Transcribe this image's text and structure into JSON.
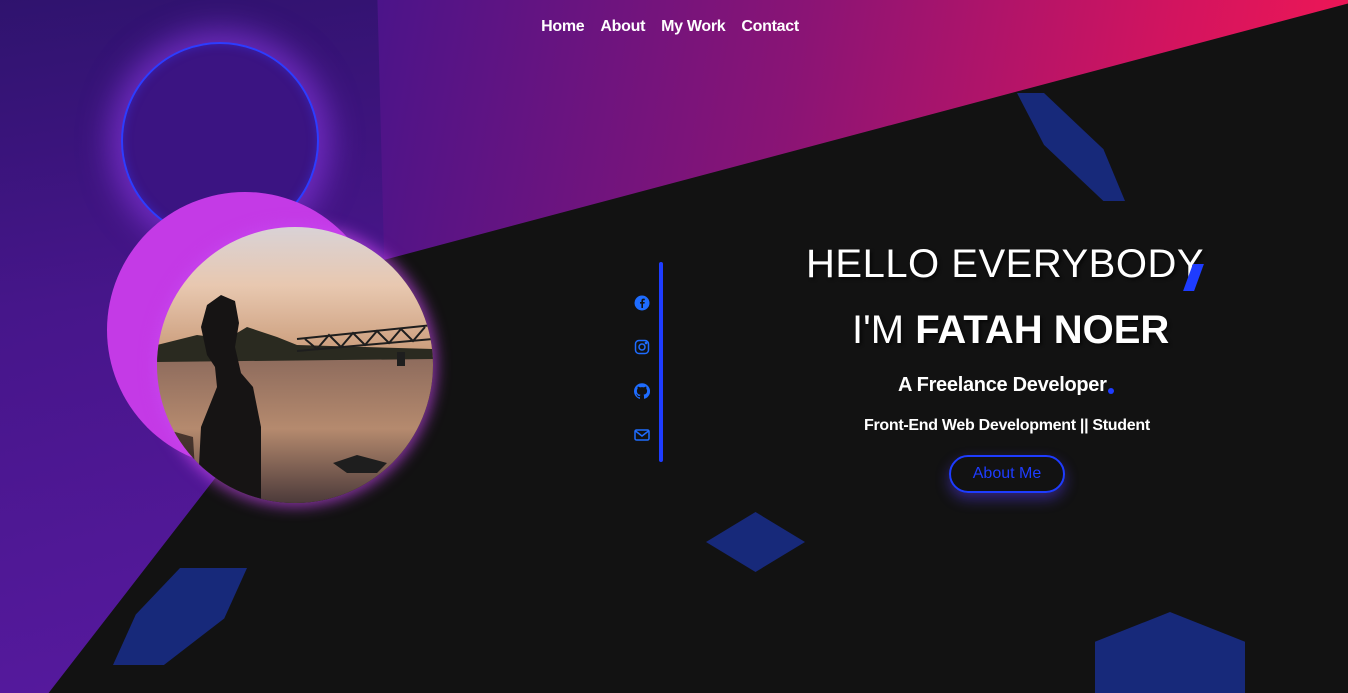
{
  "nav": {
    "items": [
      {
        "label": "Home"
      },
      {
        "label": "About"
      },
      {
        "label": "My Work"
      },
      {
        "label": "Contact"
      }
    ]
  },
  "hero": {
    "greeting": "HELLO EVERYBODY",
    "intro_prefix": "I'M",
    "name": "FATAH NOER",
    "role": "A Freelance Developer",
    "tagline": "Front-End Web Development || Student",
    "cta_label": "About Me"
  },
  "social": [
    {
      "icon": "facebook-icon"
    },
    {
      "icon": "instagram-icon"
    },
    {
      "icon": "github-icon"
    },
    {
      "icon": "mail-icon"
    }
  ],
  "colors": {
    "accent": "#1e3cff",
    "background": "#121212",
    "gradient_start": "#2a1470",
    "gradient_end": "#ff1850",
    "magenta": "#c43ae6",
    "shape": "#17297a"
  }
}
